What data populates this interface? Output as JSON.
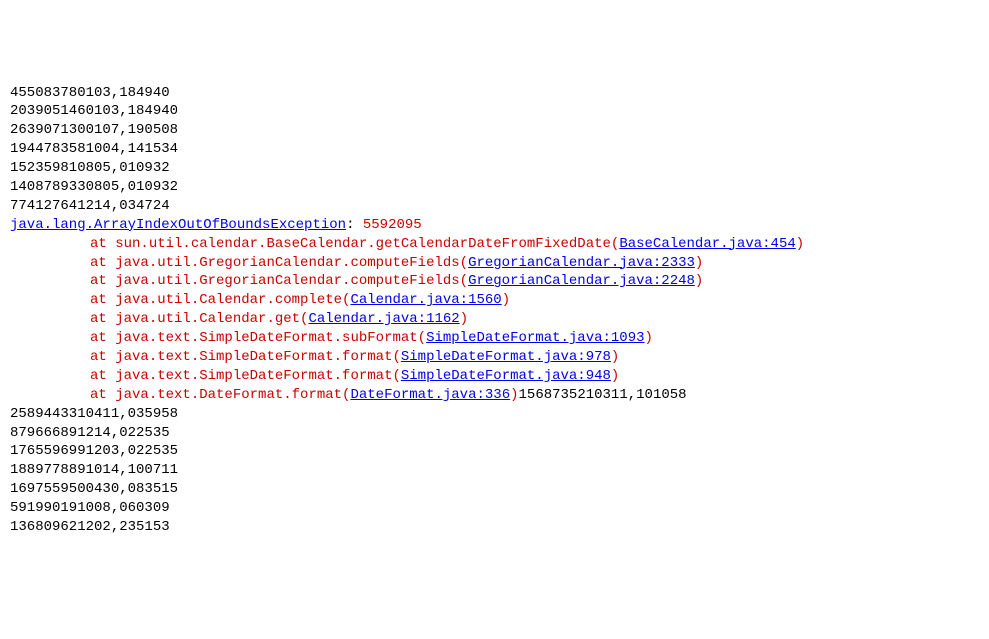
{
  "pre_lines": [
    "455083780103,184940",
    "2039051460103,184940",
    "2639071300107,190508",
    "1944783581004,141534",
    "152359810805,010932",
    "1408789330805,010932",
    "774127641214,034724"
  ],
  "exception": {
    "class_name": "java.lang.ArrayIndexOutOfBoundsException",
    "message": "5592095"
  },
  "stack": [
    {
      "prefix": "sun.util.calendar.BaseCalendar.getCalendarDateFromFixedDate(",
      "link": "BaseCalendar.java:454",
      "suffix": ")"
    },
    {
      "prefix": "java.util.GregorianCalendar.computeFields(",
      "link": "GregorianCalendar.java:2333",
      "suffix": ")"
    },
    {
      "prefix": "java.util.GregorianCalendar.computeFields(",
      "link": "GregorianCalendar.java:2248",
      "suffix": ")"
    },
    {
      "prefix": "java.util.Calendar.complete(",
      "link": "Calendar.java:1560",
      "suffix": ")"
    },
    {
      "prefix": "java.util.Calendar.get(",
      "link": "Calendar.java:1162",
      "suffix": ")"
    },
    {
      "prefix": "java.text.SimpleDateFormat.subFormat(",
      "link": "SimpleDateFormat.java:1093",
      "suffix": ")"
    },
    {
      "prefix": "java.text.SimpleDateFormat.format(",
      "link": "SimpleDateFormat.java:978",
      "suffix": ")"
    },
    {
      "prefix": "java.text.SimpleDateFormat.format(",
      "link": "SimpleDateFormat.java:948",
      "suffix": ")"
    },
    {
      "prefix": "java.text.DateFormat.format(",
      "link": "DateFormat.java:336",
      "suffix": ")",
      "tail": "1568735210311,101058"
    }
  ],
  "post_lines": [
    "2589443310411,035958",
    "879666891214,022535",
    "1765596991203,022535",
    "1889778891014,100711",
    "1697559500430,083515",
    "591990191008,060309",
    "136809621202,235153"
  ],
  "labels": {
    "at": "at "
  }
}
